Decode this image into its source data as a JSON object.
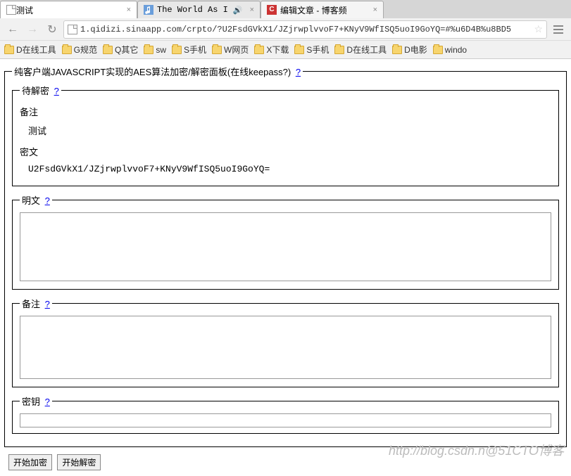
{
  "tabs": [
    {
      "title": "测试",
      "active": true
    },
    {
      "title": "The World As I",
      "active": false,
      "audio": true
    },
    {
      "title": "编辑文章 - 博客频",
      "active": false,
      "brand": "C"
    }
  ],
  "url": "1.qidizi.sinaapp.com/crpto/?U2FsdGVkX1/JZjrwplvvoF7+KNyV9WfISQ5uoI9GoYQ=#%u6D4B%u8BD5",
  "bookmarks": [
    {
      "label": "D在线工具"
    },
    {
      "label": "G规范"
    },
    {
      "label": "Q其它"
    },
    {
      "label": "sw"
    },
    {
      "label": "S手机"
    },
    {
      "label": "W网页"
    },
    {
      "label": "X下载"
    },
    {
      "label": "S手机"
    },
    {
      "label": "D在线工具"
    },
    {
      "label": "D电影"
    },
    {
      "label": "windo"
    }
  ],
  "main": {
    "fieldset_title": "纯客户端JAVASCRIPT实现的AES算法加密/解密面板(在线keepass?) ",
    "q_link": "?",
    "section_decrypt": "待解密 ",
    "note_label": "备注",
    "note_value": "测试",
    "cipher_label": "密文",
    "cipher_value": "U2FsdGVkX1/JZjrwplvvoF7+KNyV9WfISQ5uoI9GoYQ=",
    "plain_label": "明文 ",
    "note2_label": "备注 ",
    "key_label": "密钥 ",
    "btn_encrypt": "开始加密",
    "btn_decrypt": "开始解密"
  },
  "watermark": "http://blog.csdn.n@51CTO博客"
}
